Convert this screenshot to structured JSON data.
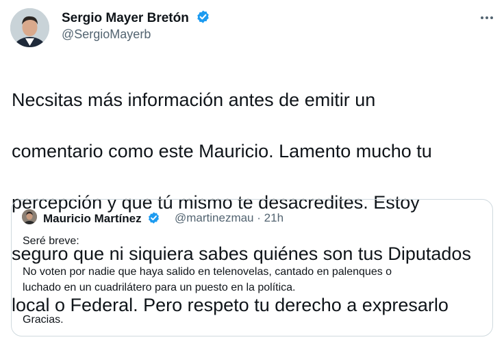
{
  "tweet": {
    "author": {
      "name": "Sergio Mayer Bretón",
      "handle": "@SergioMayerb",
      "verified": true,
      "avatar_icon": "profile-photo"
    },
    "text_lines": [
      "Necsitas más información antes de emitir un",
      "comentario como este Mauricio. Lamento mucho tu",
      "percepción y que tú mismo te desacredites. Estoy",
      "seguro que ni siquiera sabes quiénes son tus Diputados",
      "local o Federal. Pero respeto tu derecho a expresarlo"
    ]
  },
  "quoted_tweet": {
    "author": {
      "name": "Mauricio Martínez",
      "handle": "@martinezmau",
      "separator": "·",
      "time": "21h",
      "verified": true
    },
    "text_lines": [
      "Seré breve:",
      "No voten por nadie que haya salido en telenovelas, cantado en palenques o",
      "luchado en un cuadrilátero para un puesto en la política.",
      "Gracias."
    ]
  },
  "colors": {
    "text": "#0f1419",
    "secondary": "#536471",
    "verified": "#1d9bf0",
    "border": "#cfd9de"
  }
}
